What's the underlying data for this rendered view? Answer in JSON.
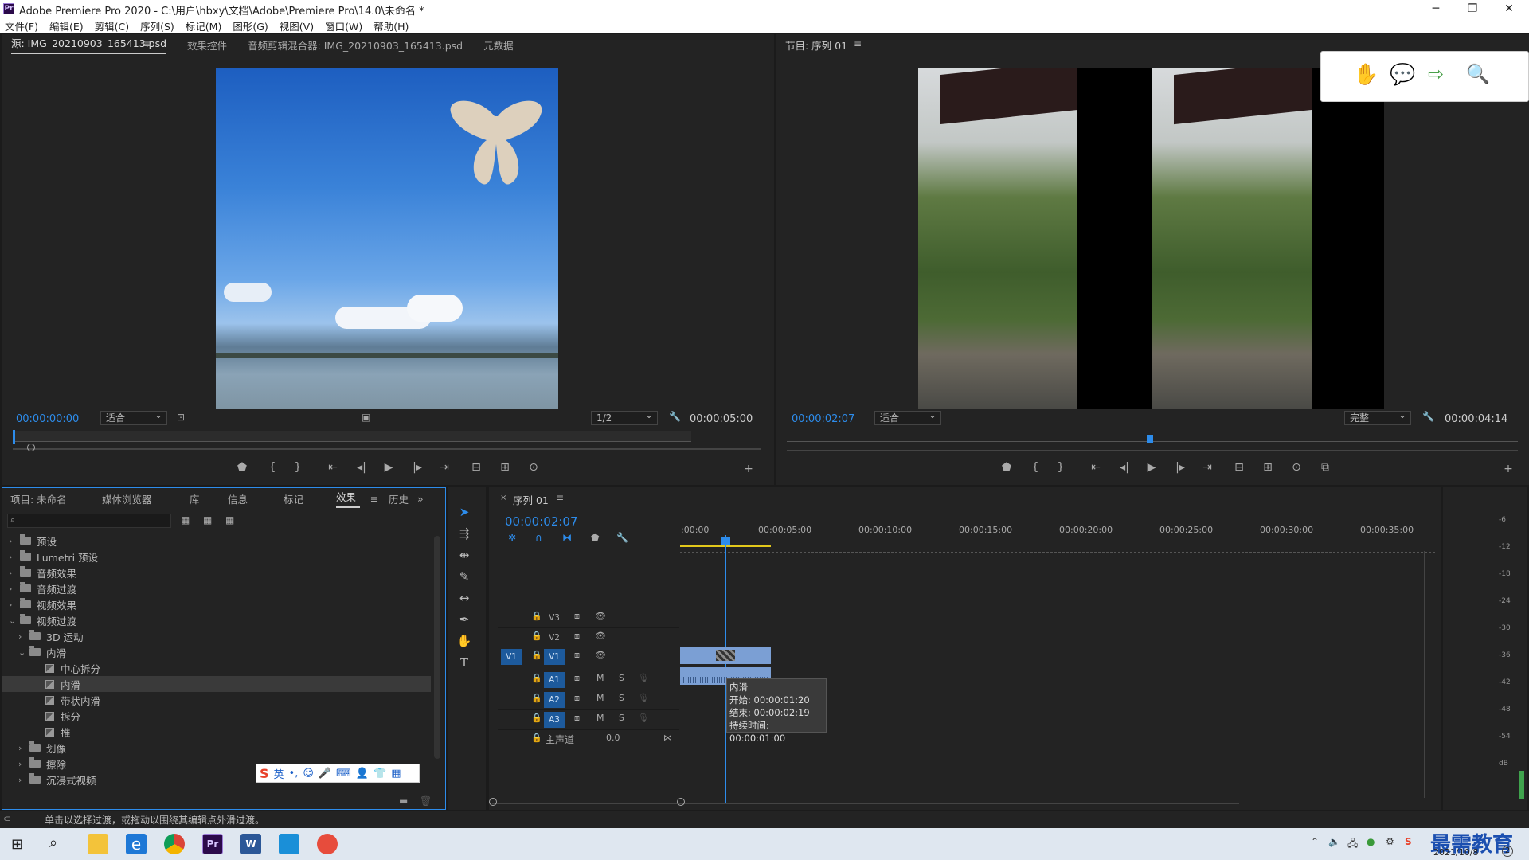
{
  "app": {
    "title": "Adobe Premiere Pro 2020 - C:\\用户\\hbxy\\文档\\Adobe\\Premiere Pro\\14.0\\未命名 *",
    "menus": [
      "文件(F)",
      "编辑(E)",
      "剪辑(C)",
      "序列(S)",
      "标记(M)",
      "图形(G)",
      "视图(V)",
      "窗口(W)",
      "帮助(H)"
    ]
  },
  "source": {
    "tabs": [
      "源: IMG_20210903_165413.psd",
      "效果控件",
      "音频剪辑混合器: IMG_20210903_165413.psd",
      "元数据"
    ],
    "timecode": "00:00:00:00",
    "fit": "适合",
    "resolution": "1/2",
    "duration": "00:00:05:00"
  },
  "program": {
    "tab": "节目: 序列 01",
    "timecode": "00:00:02:07",
    "fit": "适合",
    "quality": "完整",
    "duration": "00:00:04:14"
  },
  "project": {
    "tabs": [
      "项目: 未命名",
      "媒体浏览器",
      "库",
      "信息",
      "标记",
      "效果",
      "历史"
    ],
    "active_tab": "效果",
    "tree": [
      {
        "label": "预设",
        "level": 0,
        "type": "folder-preset",
        "expanded": false
      },
      {
        "label": "Lumetri 预设",
        "level": 0,
        "type": "folder-preset",
        "expanded": false
      },
      {
        "label": "音频效果",
        "level": 0,
        "type": "folder",
        "expanded": false
      },
      {
        "label": "音频过渡",
        "level": 0,
        "type": "folder",
        "expanded": false
      },
      {
        "label": "视频效果",
        "level": 0,
        "type": "folder",
        "expanded": false
      },
      {
        "label": "视频过渡",
        "level": 0,
        "type": "folder",
        "expanded": true
      },
      {
        "label": "3D 运动",
        "level": 1,
        "type": "folder",
        "expanded": false
      },
      {
        "label": "内滑",
        "level": 1,
        "type": "folder",
        "expanded": true
      },
      {
        "label": "中心拆分",
        "level": 2,
        "type": "fx"
      },
      {
        "label": "内滑",
        "level": 2,
        "type": "fx",
        "selected": true
      },
      {
        "label": "带状内滑",
        "level": 2,
        "type": "fx"
      },
      {
        "label": "拆分",
        "level": 2,
        "type": "fx"
      },
      {
        "label": "推",
        "level": 2,
        "type": "fx"
      },
      {
        "label": "划像",
        "level": 1,
        "type": "folder",
        "expanded": false
      },
      {
        "label": "擦除",
        "level": 1,
        "type": "folder",
        "expanded": false
      },
      {
        "label": "沉浸式视频",
        "level": 1,
        "type": "folder",
        "expanded": false
      }
    ],
    "ime": "英"
  },
  "timeline": {
    "tab": "序列 01",
    "timecode": "00:00:02:07",
    "ruler": [
      ":00:00",
      "00:00:05:00",
      "00:00:10:00",
      "00:00:15:00",
      "00:00:20:00",
      "00:00:25:00",
      "00:00:30:00",
      "00:00:35:00"
    ],
    "video_tracks": [
      "V3",
      "V2",
      "V1"
    ],
    "audio_tracks": [
      "A1",
      "A2",
      "A3"
    ],
    "source_patch_v": "V1",
    "master": {
      "label": "主声道",
      "value": "0.0"
    },
    "tooltip": {
      "name": "内滑",
      "start": "开始: 00:00:01:20",
      "end": "结束: 00:00:02:19",
      "duration": "持续时间: 00:00:01:00"
    },
    "track_m": "M",
    "track_s": "S"
  },
  "meter": {
    "labels": [
      "-6",
      "-12",
      "-18",
      "-24",
      "-30",
      "-36",
      "-42",
      "-48",
      "-54",
      "dB"
    ]
  },
  "status": "单击以选择过渡，或拖动以围绕其编辑点外滑过渡。",
  "taskbar": {
    "date": "2021/10/8",
    "watermark": "最需教育",
    "badge": "2"
  },
  "colors": {
    "accent": "#2d8ceb",
    "clip": "#7b9fd4",
    "panel": "#232323"
  }
}
